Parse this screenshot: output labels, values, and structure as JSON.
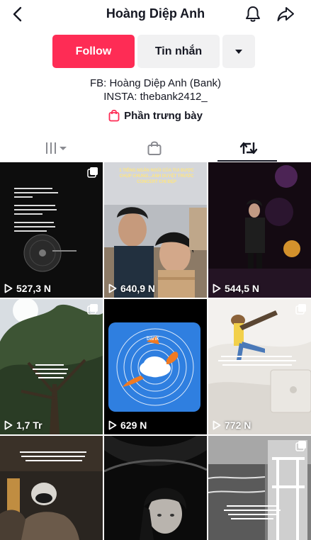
{
  "header": {
    "title": "Hoàng Diệp Anh",
    "back_icon": "chevron-left-icon",
    "bell_icon": "bell-icon",
    "share_icon": "share-arrow-icon"
  },
  "actions": {
    "follow_label": "Follow",
    "message_label": "Tin nhắn",
    "more_icon": "caret-down-icon"
  },
  "bio": {
    "line1": "FB: Hoàng Diệp Anh (Bank)",
    "line2": "INSTA: thebank2412_"
  },
  "showcase": {
    "label": "Phần trưng bày",
    "icon": "shopping-bag-icon"
  },
  "tabs": [
    {
      "icon": "grid-bars-icon",
      "active": false
    },
    {
      "icon": "shopping-bag-icon",
      "active": false
    },
    {
      "icon": "repost-icon",
      "active": true
    }
  ],
  "colors": {
    "accent": "#fe2c55",
    "secondary_bg": "#f1f1f2",
    "text": "#161823"
  },
  "videos": [
    {
      "views": "527,3 N",
      "multi": true
    },
    {
      "views": "640,9 N",
      "multi": false,
      "caption": "1 TIẾNG NGẮN NGỦI CỦA TUI ĐƯỢC CHỤP CHUNG...ANH DUYỆT TRƯỚC CONCERT CHỊ ĐẸP"
    },
    {
      "views": "544,5 N",
      "multi": false
    },
    {
      "views": "1,7 Tr",
      "multi": true
    },
    {
      "views": "629 N",
      "multi": false,
      "caption": "bank"
    },
    {
      "views": "772 N",
      "multi": true
    },
    {
      "views": "",
      "multi": false
    },
    {
      "views": "",
      "multi": false
    },
    {
      "views": "",
      "multi": true
    }
  ]
}
